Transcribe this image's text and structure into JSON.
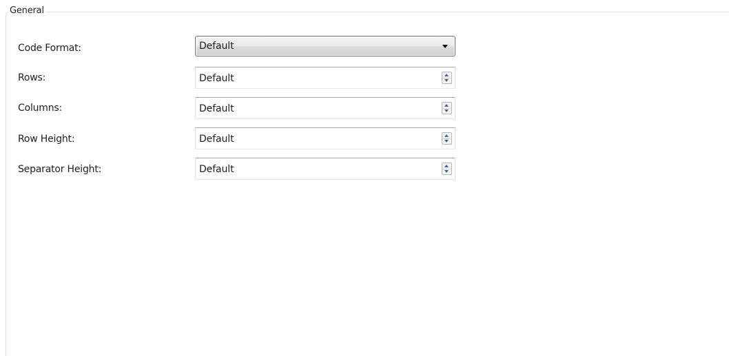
{
  "group": {
    "title": "General"
  },
  "fields": {
    "code_format": {
      "label": "Code Format:",
      "value": "Default",
      "control": "combobox"
    },
    "rows": {
      "label": "Rows:",
      "value": "Default",
      "control": "spinner"
    },
    "columns": {
      "label": "Columns:",
      "value": "Default",
      "control": "spinner"
    },
    "row_height": {
      "label": "Row Height:",
      "value": "Default",
      "control": "spinner"
    },
    "separator_height": {
      "label": "Separator Height:",
      "value": "Default",
      "control": "spinner"
    }
  },
  "icons": {
    "combo_arrow": "chevron-down-icon",
    "spin_up": "spin-up-icon",
    "spin_down": "spin-down-icon"
  },
  "colors": {
    "group_border": "#d5dfe5",
    "spinner_arrow": "#4d6185",
    "text": "#1e1e1e"
  }
}
